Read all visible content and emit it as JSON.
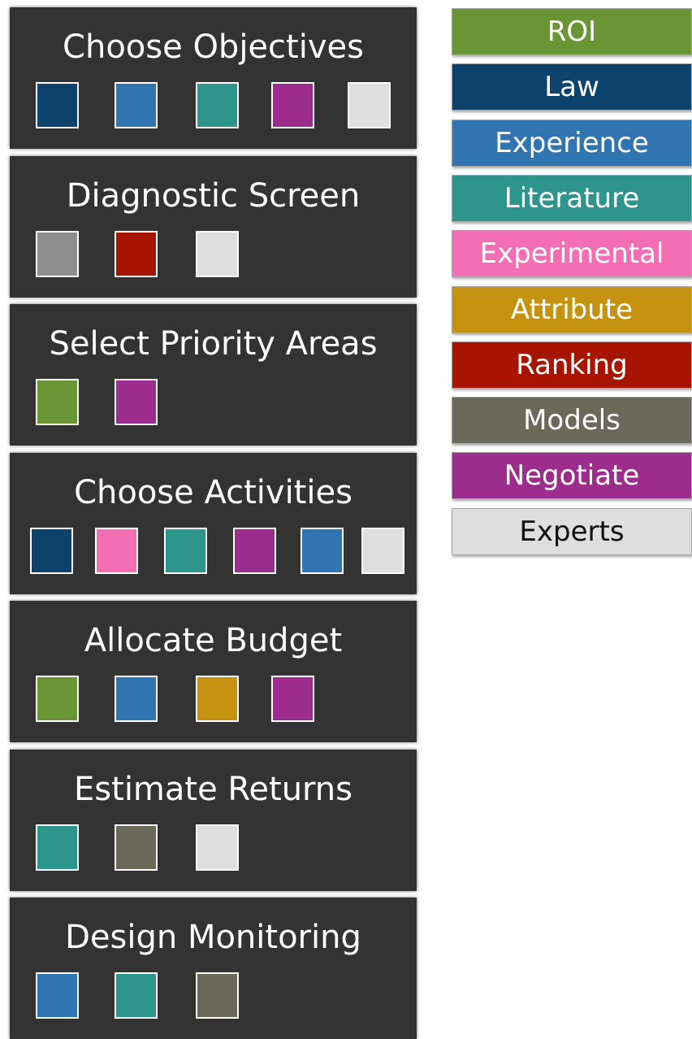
{
  "colors": {
    "ROI": "#6a9535",
    "Law": "#0d426c",
    "Experience": "#3074b2",
    "Literature": "#2e958c",
    "Experimental": "#f56eb4",
    "Attribute": "#c5930f",
    "Ranking": "#a71400",
    "Models": "#6a695a",
    "Negotiate": "#9d2d8c",
    "Experts": "#dedede",
    "Gray": "#8e8e8e"
  },
  "steps": [
    {
      "title": "Choose Objectives",
      "swatches": [
        "Law",
        "Experience",
        "Literature",
        "Negotiate",
        "Experts"
      ]
    },
    {
      "title": "Diagnostic Screen",
      "swatches": [
        "Gray",
        "Ranking",
        "Experts"
      ]
    },
    {
      "title": "Select Priority Areas",
      "swatches": [
        "ROI",
        "Negotiate"
      ]
    },
    {
      "title": "Choose Activities",
      "swatches": [
        "Law",
        "Experimental",
        "Literature",
        "Negotiate",
        "Experience",
        "Experts"
      ]
    },
    {
      "title": "Allocate Budget",
      "swatches": [
        "ROI",
        "Experience",
        "Attribute",
        "Negotiate"
      ]
    },
    {
      "title": "Estimate Returns",
      "swatches": [
        "Literature",
        "Models",
        "Experts"
      ]
    },
    {
      "title": "Design Monitoring",
      "swatches": [
        "Experience",
        "Literature",
        "Models"
      ]
    }
  ],
  "legend": [
    {
      "label": "ROI",
      "color": "ROI",
      "text_color": "#ffffff"
    },
    {
      "label": "Law",
      "color": "Law",
      "text_color": "#ffffff"
    },
    {
      "label": "Experience",
      "color": "Experience",
      "text_color": "#ffffff"
    },
    {
      "label": "Literature",
      "color": "Literature",
      "text_color": "#ffffff"
    },
    {
      "label": "Experimental",
      "color": "Experimental",
      "text_color": "#ffffff"
    },
    {
      "label": "Attribute",
      "color": "Attribute",
      "text_color": "#ffffff"
    },
    {
      "label": "Ranking",
      "color": "Ranking",
      "text_color": "#ffffff"
    },
    {
      "label": "Models",
      "color": "Models",
      "text_color": "#ffffff"
    },
    {
      "label": "Negotiate",
      "color": "Negotiate",
      "text_color": "#ffffff"
    },
    {
      "label": "Experts",
      "color": "Experts",
      "text_color": "#111111"
    }
  ]
}
